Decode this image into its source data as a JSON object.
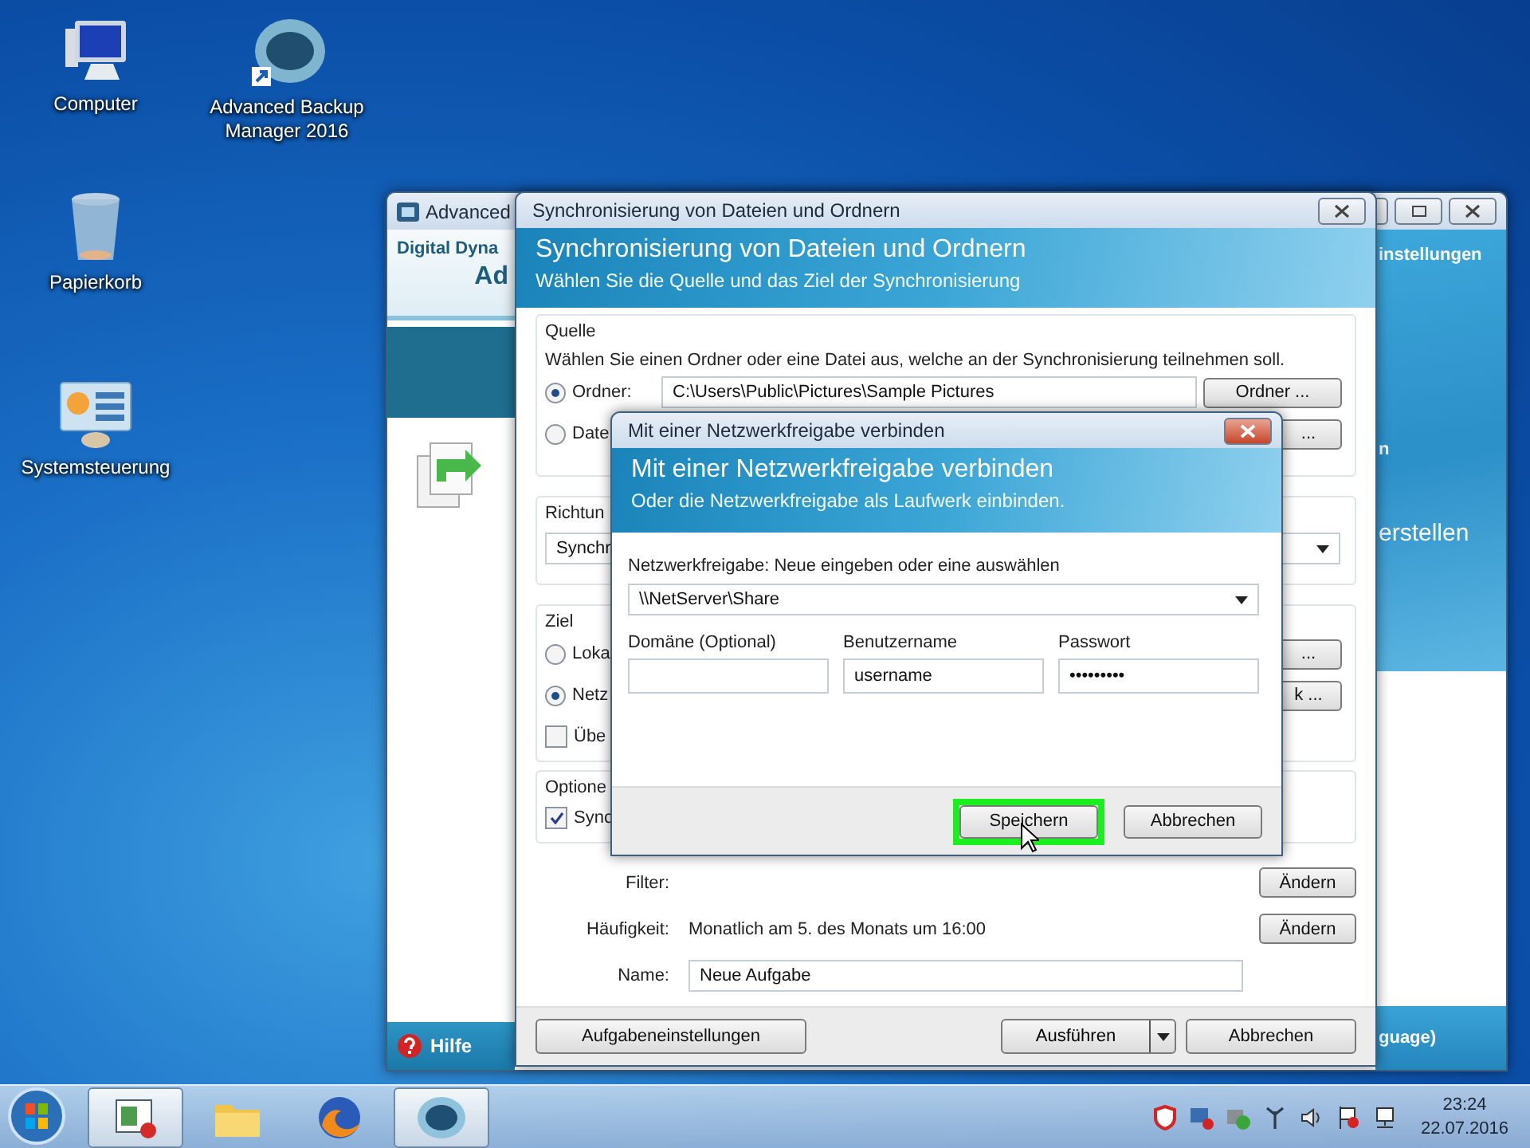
{
  "desktop_icons": [
    {
      "kind": "computer",
      "label": "Computer"
    },
    {
      "kind": "app",
      "label": "Advanced Backup Manager 2016"
    },
    {
      "kind": "recycle-bin",
      "label": "Papierkorb"
    },
    {
      "kind": "control-panel",
      "label": "Systemsteuerung"
    }
  ],
  "main_window": {
    "title": "Advanced",
    "brand_line": "Digital Dyna",
    "brand_title": "Ad",
    "help": "Hilfe",
    "side_labels": [
      "instellungen",
      "n",
      "erstellen"
    ],
    "footer_label": "guage)"
  },
  "sync_dialog": {
    "title": "Synchronisierung von Dateien und Ordnern",
    "heading": "Synchronisierung von Dateien und Ordnern",
    "subheading": "Wählen Sie die Quelle und das Ziel der Synchronisierung",
    "source": {
      "label": "Quelle",
      "hint": "Wählen Sie einen Ordner oder eine Datei aus, welche an der Synchronisierung teilnehmen soll.",
      "options": [
        {
          "label": "Ordner:",
          "selected": true,
          "value": "C:\\Users\\Public\\Pictures\\Sample Pictures",
          "button": "Ordner ..."
        },
        {
          "label": "Date",
          "selected": false,
          "button": "..."
        }
      ]
    },
    "direction": {
      "label": "Richtun",
      "value": "Synchr"
    },
    "target": {
      "label": "Ziel",
      "options": [
        {
          "label": "Loka",
          "selected": false,
          "button": "..."
        },
        {
          "label": "Netz",
          "selected": true,
          "button": "k ..."
        }
      ],
      "checkbox": {
        "label": "Übe",
        "checked": false
      }
    },
    "options": {
      "label": "Optione",
      "checkbox": {
        "label": "Sync",
        "checked": true
      }
    },
    "rows": [
      {
        "kind": "text",
        "label": "Filter:",
        "button": "Ändern"
      },
      {
        "kind": "text",
        "label": "Häufigkeit:",
        "value": "Monatlich am 5. des Monats um 16:00",
        "button": "Ändern"
      },
      {
        "kind": "input",
        "label": "Name:",
        "value": "Neue Aufgabe"
      }
    ],
    "footer": {
      "settings": "Aufgabeneinstellungen",
      "run": "Ausführen",
      "cancel": "Abbrechen"
    }
  },
  "network_dialog": {
    "title": "Mit einer Netzwerkfreigabe verbinden",
    "heading": "Mit einer Netzwerkfreigabe verbinden",
    "subheading": "Oder die Netzwerkfreigabe als Laufwerk einbinden.",
    "share_label": "Netzwerkfreigabe: Neue eingeben oder eine auswählen",
    "share_value": "\\\\NetServer\\Share",
    "fields": [
      {
        "label": "Domäne (Optional)"
      },
      {
        "label": "Benutzername",
        "value": "username"
      },
      {
        "label": "Passwort",
        "value": "•••••••••"
      }
    ],
    "save": "Speichern",
    "save_highlighted": true,
    "cancel": "Abbrechen"
  },
  "taskbar": {
    "items": [
      {
        "kind": "presentation",
        "selected": true
      },
      {
        "kind": "folder",
        "selected": false
      },
      {
        "kind": "browser",
        "selected": false
      },
      {
        "kind": "app",
        "selected": true
      }
    ],
    "time": "23:24",
    "date": "22.07.2016"
  }
}
